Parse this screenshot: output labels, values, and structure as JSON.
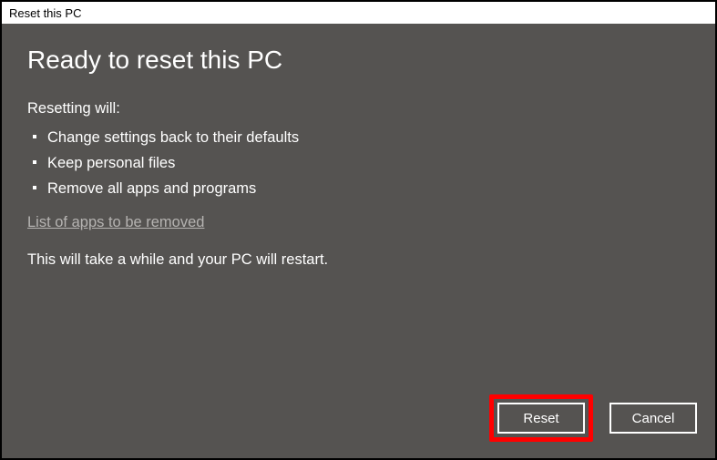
{
  "titlebar": {
    "title": "Reset this PC"
  },
  "main": {
    "heading": "Ready to reset this PC",
    "subheading": "Resetting will:",
    "bullets": [
      "Change settings back to their defaults",
      "Keep personal files",
      "Remove all apps and programs"
    ],
    "link": "List of apps to be removed",
    "info": "This will take a while and your PC will restart."
  },
  "buttons": {
    "reset": "Reset",
    "cancel": "Cancel"
  }
}
